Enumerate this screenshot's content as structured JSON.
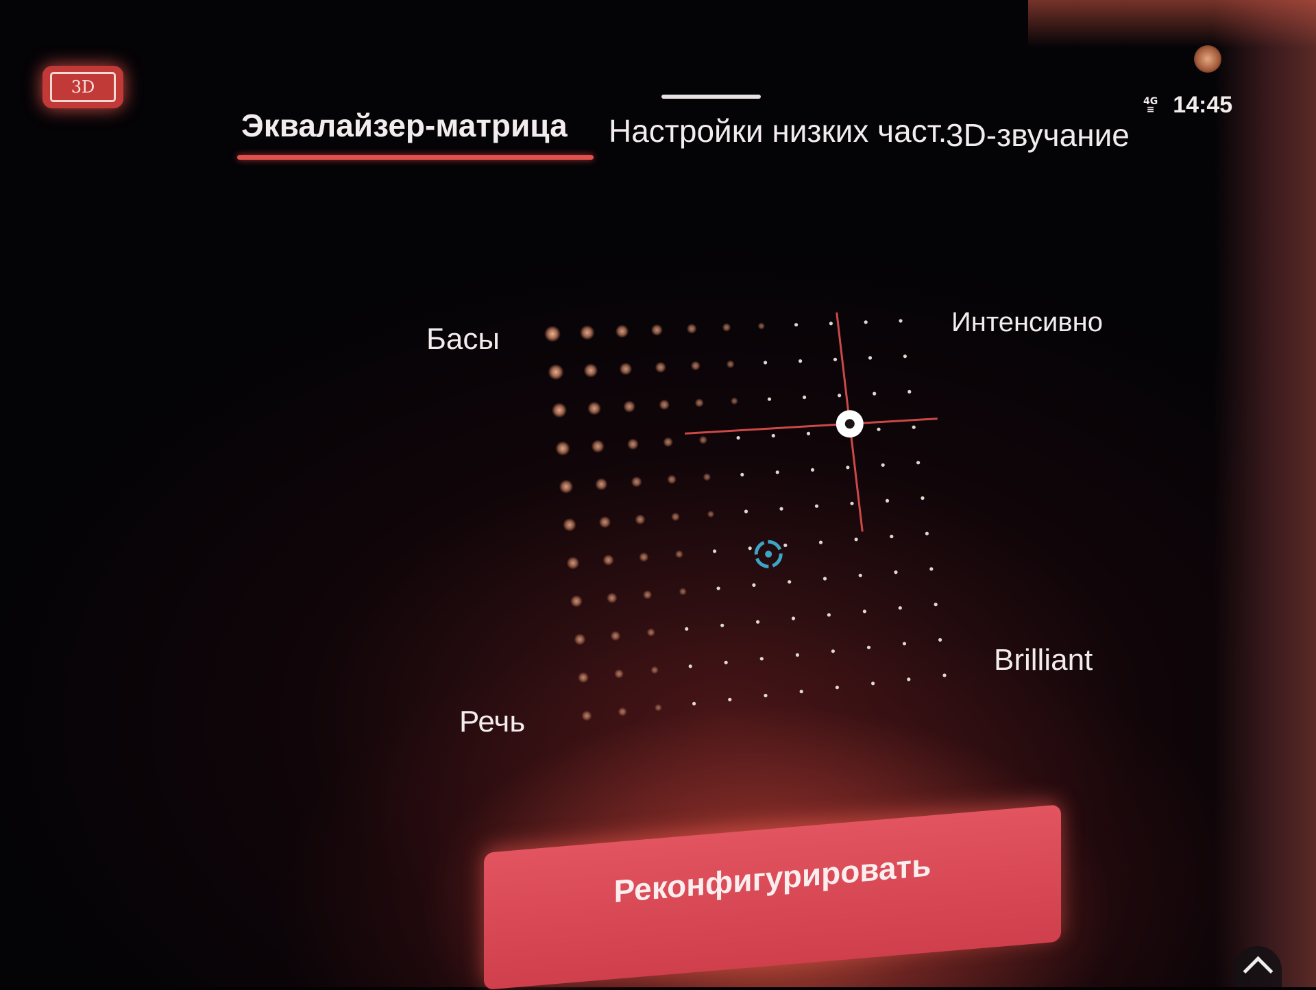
{
  "header": {
    "mode_badge": "3D",
    "tabs": [
      {
        "label": "Эквалайзер-матрица",
        "active": true
      },
      {
        "label": "Настройки низких част.",
        "active": false
      },
      {
        "label": "3D-звучание",
        "active": false
      }
    ]
  },
  "status": {
    "network": [
      "4G",
      "≡"
    ],
    "time": "14:45"
  },
  "matrix": {
    "corner_labels": {
      "top_left": "Басы",
      "top_right": "Интенсивно",
      "bottom_left": "Речь",
      "bottom_right": "Brilliant"
    },
    "grid_size": [
      11,
      11
    ],
    "selected_position": [
      0.82,
      0.28
    ],
    "neutral_position": [
      0.55,
      0.62
    ],
    "colors": {
      "accent": "#e0514e",
      "neutral_marker": "#3da6c8",
      "dot_warm": "#c98a6c",
      "dot_cool": "#f5efe8"
    }
  },
  "actions": {
    "reconfigure_label": "Реконфигурировать"
  },
  "icons": {
    "collapse": "chevron-up-icon",
    "selector": "crosshair-handle-icon",
    "neutral": "target-icon"
  }
}
